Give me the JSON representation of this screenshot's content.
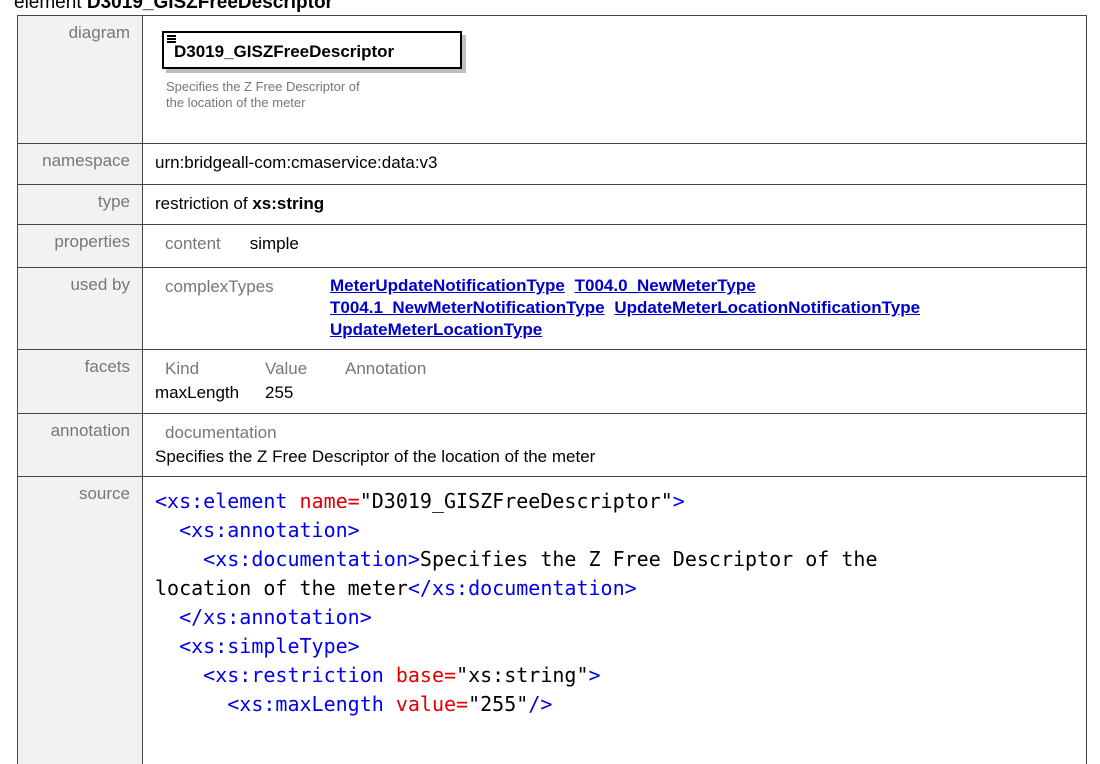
{
  "heading": {
    "prefix": "element",
    "name": "D3019_GISZFreeDescriptor"
  },
  "labels": {
    "diagram": "diagram",
    "namespace": "namespace",
    "type": "type",
    "properties": "properties",
    "used_by": "used by",
    "facets": "facets",
    "annotation": "annotation",
    "source": "source"
  },
  "diagram": {
    "title": "D3019_GISZFreeDescriptor",
    "description_line1": "Specifies the Z Free Descriptor of",
    "description_line2": "the location of the meter"
  },
  "namespace": "urn:bridgeall-com:cmaservice:data:v3",
  "type": {
    "prefix": "restriction of",
    "base": "xs:string"
  },
  "properties": {
    "key": "content",
    "value": "simple"
  },
  "used_by": {
    "key": "complexTypes",
    "links": [
      "MeterUpdateNotificationType",
      "T004.0_NewMeterType",
      "T004.1_NewMeterNotificationType",
      "UpdateMeterLocationNotificationType",
      "UpdateMeterLocationType"
    ]
  },
  "facets": {
    "headers": [
      "Kind",
      "Value",
      "Annotation"
    ],
    "rows": [
      {
        "kind": "maxLength",
        "value": "255"
      }
    ]
  },
  "annotation": {
    "key": "documentation",
    "text": "Specifies the Z Free Descriptor of the location of the meter"
  },
  "source": {
    "element_open": "<xs:element",
    "element_attr": "name=",
    "element_name": "\"D3019_GISZFreeDescriptor\"",
    "element_close": ">",
    "annotation_open": "<xs:annotation>",
    "doc_open": "<xs:documentation>",
    "doc_text_1": "Specifies the Z Free Descriptor of the",
    "doc_text_2": "location of the meter",
    "doc_close": "</xs:documentation>",
    "annotation_close": "</xs:annotation>",
    "simple_open": "<xs:simpleType>",
    "restriction_open": "<xs:restriction",
    "restriction_attr": "base=",
    "restriction_val": "\"xs:string\"",
    "restriction_close": ">",
    "maxlength_open": "<xs:maxLength",
    "maxlength_attr": "value=",
    "maxlength_val": "\"255\"",
    "maxlength_close": "/>"
  }
}
